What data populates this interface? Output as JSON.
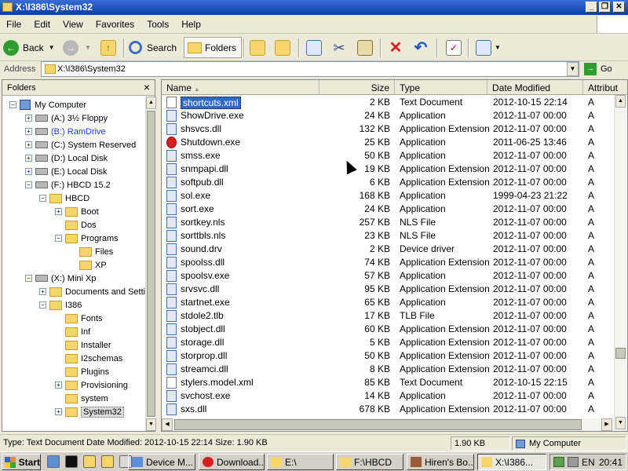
{
  "window": {
    "title": "X:\\I386\\System32"
  },
  "menu": [
    "File",
    "Edit",
    "View",
    "Favorites",
    "Tools",
    "Help"
  ],
  "toolbar": {
    "back_label": "Back",
    "search_label": "Search",
    "folders_label": "Folders"
  },
  "address": {
    "label": "Address",
    "value": "X:\\I386\\System32",
    "go_label": "Go"
  },
  "folders_pane": {
    "title": "Folders",
    "tree": [
      {
        "label": "My Computer",
        "icon": "computer-icon",
        "expander": "−"
      },
      {
        "label": "(A:) 3½ Floppy",
        "icon": "floppy-icon",
        "expander": "+"
      },
      {
        "label": "(B:) RamDrive",
        "icon": "drive-icon",
        "expander": "+",
        "color": "#1a3cc8"
      },
      {
        "label": "(C:) System Reserved",
        "icon": "drive-icon",
        "expander": "+"
      },
      {
        "label": "(D:) Local Disk",
        "icon": "drive-icon",
        "expander": "+"
      },
      {
        "label": "(E:) Local Disk",
        "icon": "drive-icon",
        "expander": "+"
      },
      {
        "label": "(F:) HBCD 15.2",
        "icon": "cd-drive-icon",
        "expander": "−"
      },
      {
        "label": "HBCD",
        "icon": "folder-icon",
        "expander": "−"
      },
      {
        "label": "Boot",
        "icon": "folder-icon",
        "expander": "+"
      },
      {
        "label": "Dos",
        "icon": "folder-icon",
        "expander": ""
      },
      {
        "label": "Programs",
        "icon": "folder-icon",
        "expander": "−"
      },
      {
        "label": "Files",
        "icon": "folder-icon",
        "expander": ""
      },
      {
        "label": "XP",
        "icon": "folder-icon",
        "expander": ""
      },
      {
        "label": "(X:) Mini Xp",
        "icon": "drive-icon",
        "expander": "−"
      },
      {
        "label": "Documents and Setti",
        "icon": "folder-icon",
        "expander": "+"
      },
      {
        "label": "I386",
        "icon": "folder-icon",
        "expander": "−"
      },
      {
        "label": "Fonts",
        "icon": "folder-icon",
        "expander": ""
      },
      {
        "label": "Inf",
        "icon": "folder-icon",
        "expander": ""
      },
      {
        "label": "Installer",
        "icon": "folder-icon",
        "expander": ""
      },
      {
        "label": "I2schemas",
        "icon": "folder-icon",
        "expander": ""
      },
      {
        "label": "Plugins",
        "icon": "folder-icon",
        "expander": ""
      },
      {
        "label": "Provisioning",
        "icon": "folder-icon",
        "expander": "+"
      },
      {
        "label": "system",
        "icon": "folder-icon",
        "expander": ""
      },
      {
        "label": "System32",
        "icon": "folder-icon",
        "expander": "+",
        "selected": true
      }
    ]
  },
  "columns": {
    "name": "Name",
    "size": "Size",
    "type": "Type",
    "modified": "Date Modified",
    "attributes": "Attribut"
  },
  "files": [
    {
      "name": "shortcuts.xml",
      "size": "2 KB",
      "type": "Text Document",
      "modified": "2012-10-15 22:14",
      "attr": "A",
      "selected": true,
      "icon": "text-document-icon"
    },
    {
      "name": "ShowDrive.exe",
      "size": "24 KB",
      "type": "Application",
      "modified": "2012-11-07 00:00",
      "attr": "A",
      "icon": "application-icon"
    },
    {
      "name": "shsvcs.dll",
      "size": "132 KB",
      "type": "Application Extension",
      "modified": "2012-11-07 00:00",
      "attr": "A",
      "icon": "dll-icon"
    },
    {
      "name": "Shutdown.exe",
      "size": "25 KB",
      "type": "Application",
      "modified": "2011-06-25 13:46",
      "attr": "A",
      "icon": "shutdown-icon"
    },
    {
      "name": "smss.exe",
      "size": "50 KB",
      "type": "Application",
      "modified": "2012-11-07 00:00",
      "attr": "A",
      "icon": "application-icon"
    },
    {
      "name": "snmpapi.dll",
      "size": "19 KB",
      "type": "Application Extension",
      "modified": "2012-11-07 00:00",
      "attr": "A",
      "icon": "dll-icon"
    },
    {
      "name": "softpub.dll",
      "size": "6 KB",
      "type": "Application Extension",
      "modified": "2012-11-07 00:00",
      "attr": "A",
      "icon": "dll-icon"
    },
    {
      "name": "sol.exe",
      "size": "168 KB",
      "type": "Application",
      "modified": "1999-04-23 21:22",
      "attr": "A",
      "icon": "solitaire-icon"
    },
    {
      "name": "sort.exe",
      "size": "24 KB",
      "type": "Application",
      "modified": "2012-11-07 00:00",
      "attr": "A",
      "icon": "application-icon"
    },
    {
      "name": "sortkey.nls",
      "size": "257 KB",
      "type": "NLS File",
      "modified": "2012-11-07 00:00",
      "attr": "A",
      "icon": "nls-icon"
    },
    {
      "name": "sorttbls.nls",
      "size": "23 KB",
      "type": "NLS File",
      "modified": "2012-11-07 00:00",
      "attr": "A",
      "icon": "nls-icon"
    },
    {
      "name": "sound.drv",
      "size": "2 KB",
      "type": "Device driver",
      "modified": "2012-11-07 00:00",
      "attr": "A",
      "icon": "driver-icon"
    },
    {
      "name": "spoolss.dll",
      "size": "74 KB",
      "type": "Application Extension",
      "modified": "2012-11-07 00:00",
      "attr": "A",
      "icon": "dll-icon"
    },
    {
      "name": "spoolsv.exe",
      "size": "57 KB",
      "type": "Application",
      "modified": "2012-11-07 00:00",
      "attr": "A",
      "icon": "application-icon"
    },
    {
      "name": "srvsvc.dll",
      "size": "95 KB",
      "type": "Application Extension",
      "modified": "2012-11-07 00:00",
      "attr": "A",
      "icon": "dll-icon"
    },
    {
      "name": "startnet.exe",
      "size": "65 KB",
      "type": "Application",
      "modified": "2012-11-07 00:00",
      "attr": "A",
      "icon": "application-icon"
    },
    {
      "name": "stdole2.tlb",
      "size": "17 KB",
      "type": "TLB File",
      "modified": "2012-11-07 00:00",
      "attr": "A",
      "icon": "tlb-icon"
    },
    {
      "name": "stobject.dll",
      "size": "60 KB",
      "type": "Application Extension",
      "modified": "2012-11-07 00:00",
      "attr": "A",
      "icon": "dll-icon"
    },
    {
      "name": "storage.dll",
      "size": "5 KB",
      "type": "Application Extension",
      "modified": "2012-11-07 00:00",
      "attr": "A",
      "icon": "dll-icon"
    },
    {
      "name": "storprop.dll",
      "size": "50 KB",
      "type": "Application Extension",
      "modified": "2012-11-07 00:00",
      "attr": "A",
      "icon": "dll-icon"
    },
    {
      "name": "streamci.dll",
      "size": "8 KB",
      "type": "Application Extension",
      "modified": "2012-11-07 00:00",
      "attr": "A",
      "icon": "dll-icon"
    },
    {
      "name": "stylers.model.xml",
      "size": "85 KB",
      "type": "Text Document",
      "modified": "2012-10-15 22:15",
      "attr": "A",
      "icon": "text-document-icon"
    },
    {
      "name": "svchost.exe",
      "size": "14 KB",
      "type": "Application",
      "modified": "2012-11-07 00:00",
      "attr": "A",
      "icon": "application-icon"
    },
    {
      "name": "sxs.dll",
      "size": "678 KB",
      "type": "Application Extension",
      "modified": "2012-11-07 00:00",
      "attr": "A",
      "icon": "dll-icon"
    }
  ],
  "status": {
    "details": "Type: Text Document Date Modified: 2012-10-15 22:14 Size: 1.90 KB",
    "size": "1.90 KB",
    "location": "My Computer"
  },
  "taskbar": {
    "start_label": "Start",
    "tasks": [
      {
        "label": "Device M...",
        "icon": "device-manager-icon"
      },
      {
        "label": "Download...",
        "icon": "download-icon"
      },
      {
        "label": "E:\\",
        "icon": "folder-icon"
      },
      {
        "label": "F:\\HBCD",
        "icon": "folder-icon"
      },
      {
        "label": "Hiren's Bo...",
        "icon": "hirens-icon"
      },
      {
        "label": "X:\\I386...",
        "icon": "folder-icon",
        "active": true
      }
    ],
    "language": "EN",
    "clock": "20:41"
  },
  "colors": {
    "title_bar": "#0a3aa8",
    "selection": "#316ac5",
    "window_face": "#ece9d8"
  }
}
